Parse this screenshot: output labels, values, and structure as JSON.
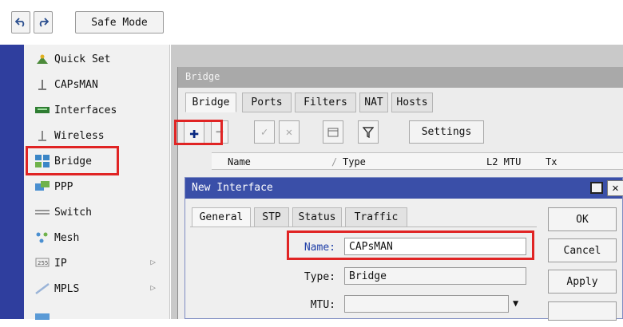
{
  "toolbar": {
    "undo_icon": "undo-icon",
    "redo_icon": "redo-icon",
    "safe_mode_label": "Safe Mode"
  },
  "sidebar": {
    "items": [
      {
        "label": "Quick Set",
        "icon": "quick-set-icon"
      },
      {
        "label": "CAPsMAN",
        "icon": "capsman-icon"
      },
      {
        "label": "Interfaces",
        "icon": "interfaces-icon"
      },
      {
        "label": "Wireless",
        "icon": "wireless-icon"
      },
      {
        "label": "Bridge",
        "icon": "bridge-icon"
      },
      {
        "label": "PPP",
        "icon": "ppp-icon"
      },
      {
        "label": "Switch",
        "icon": "switch-icon"
      },
      {
        "label": "Mesh",
        "icon": "mesh-icon"
      },
      {
        "label": "IP",
        "icon": "ip-icon",
        "has_submenu": true
      },
      {
        "label": "MPLS",
        "icon": "mpls-icon",
        "has_submenu": true
      }
    ]
  },
  "bridge_window": {
    "title": "Bridge",
    "tabs": [
      "Bridge",
      "Ports",
      "Filters",
      "NAT",
      "Hosts"
    ],
    "active_tab": "Bridge",
    "toolbar": {
      "settings_label": "Settings"
    },
    "columns": [
      "Name",
      "Type",
      "L2 MTU",
      "Tx"
    ]
  },
  "new_interface_dialog": {
    "title": "New Interface",
    "tabs": [
      "General",
      "STP",
      "Status",
      "Traffic"
    ],
    "active_tab": "General",
    "fields": {
      "name_label": "Name:",
      "name_value": "CAPsMAN",
      "type_label": "Type:",
      "type_value": "Bridge",
      "mtu_label": "MTU:",
      "mtu_value": ""
    },
    "buttons": {
      "ok": "OK",
      "cancel": "Cancel",
      "apply": "Apply"
    }
  },
  "colors": {
    "highlight": "#e02424",
    "dialog_title_bar": "#3a4fa8",
    "sidebar_strip": "#2f3e9e"
  }
}
